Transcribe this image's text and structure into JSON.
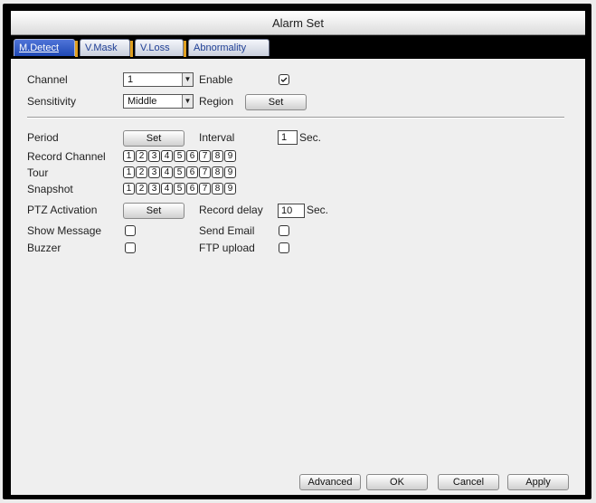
{
  "window": {
    "title": "Alarm Set"
  },
  "tabs": [
    {
      "label": "M.Detect"
    },
    {
      "label": "V.Mask"
    },
    {
      "label": "V.Loss"
    },
    {
      "label": "Abnormality"
    }
  ],
  "form": {
    "channel_label": "Channel",
    "channel_value": "1",
    "enable_label": "Enable",
    "sensitivity_label": "Sensitivity",
    "sensitivity_value": "Middle",
    "region_label": "Region",
    "region_button": "Set",
    "period_label": "Period",
    "period_button": "Set",
    "interval_label": "Interval",
    "interval_value": "1",
    "interval_unit": "Sec.",
    "record_channel_label": "Record Channel",
    "tour_label": "Tour",
    "snapshot_label": "Snapshot",
    "channel_numbers": [
      "1",
      "2",
      "3",
      "4",
      "5",
      "6",
      "7",
      "8",
      "9"
    ],
    "ptz_label": "PTZ Activation",
    "ptz_button": "Set",
    "record_delay_label": "Record delay",
    "record_delay_value": "10",
    "record_delay_unit": "Sec.",
    "show_message_label": "Show Message",
    "send_email_label": "Send Email",
    "buzzer_label": "Buzzer",
    "ftp_upload_label": "FTP upload"
  },
  "footer": {
    "advanced": "Advanced",
    "ok": "OK",
    "cancel": "Cancel",
    "apply": "Apply"
  },
  "icons": {
    "dropdown": "chevron-down-icon",
    "enable_checkbox": "checked-checkbox-icon"
  }
}
